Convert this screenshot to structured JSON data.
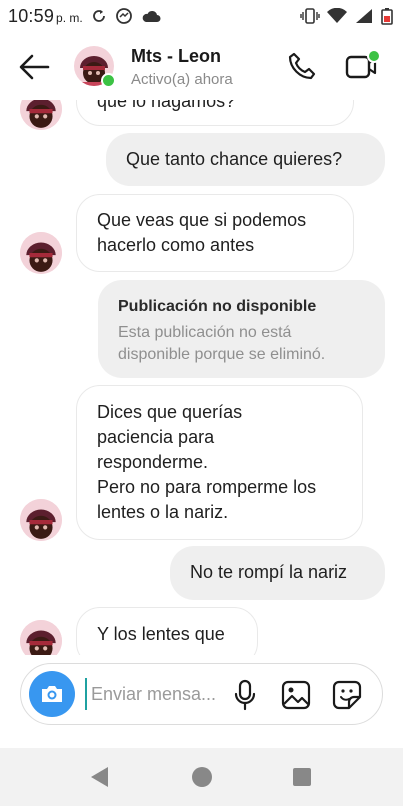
{
  "status_bar": {
    "time": "10:59",
    "ampm": "p. m.",
    "battery": "...ıll"
  },
  "header": {
    "contact_name": "Mts - Leon",
    "status": "Activo(a) ahora"
  },
  "messages": {
    "m0": "que lo hagamos?",
    "m1": "Que tanto chance quieres?",
    "m2_line1": "Que veas que si podemos",
    "m2_line2": "hacerlo como antes",
    "unavailable_title": "Publicación no disponible",
    "unavailable_line1": "Esta publicación no está",
    "unavailable_line2": "disponible porque se eliminó.",
    "m4_line1": "Dices que querías",
    "m4_line2": "paciencia para",
    "m4_line3": "responderme.",
    "m4_line4": "Pero no para romperme los",
    "m4_line5": "lentes o la nariz.",
    "m5": "No te rompí la nariz",
    "m6": "Y los lentes que"
  },
  "composer": {
    "placeholder": "Enviar mensa..."
  },
  "colors": {
    "accent": "#3897f0",
    "online": "#3cc244",
    "outgoing_bubble": "#efefef"
  },
  "icons": [
    "back-arrow-icon",
    "phone-icon",
    "video-camera-icon",
    "camera-icon",
    "microphone-icon",
    "gallery-icon",
    "sticker-icon"
  ]
}
